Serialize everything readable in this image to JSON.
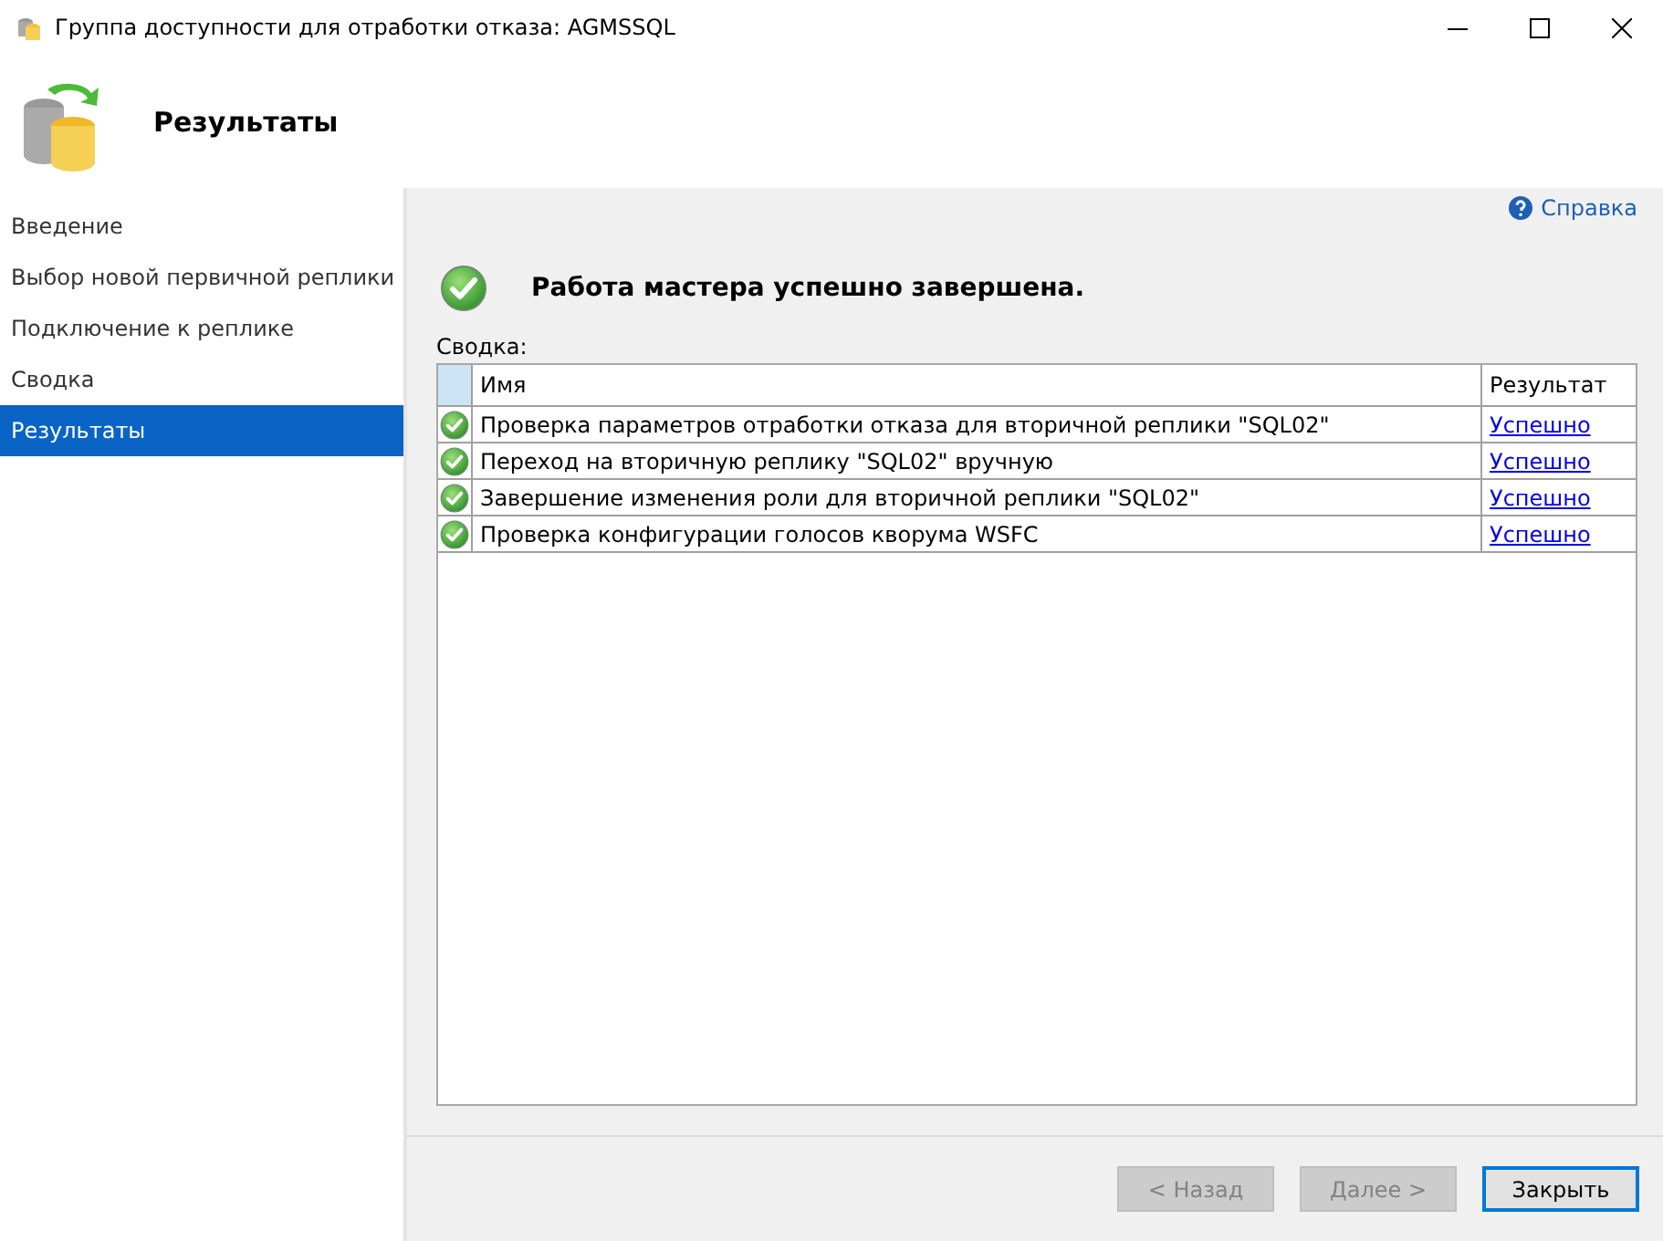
{
  "window": {
    "title": "Группа доступности для отработки отказа: AGMSSQL"
  },
  "header": {
    "title": "Результаты"
  },
  "sidebar": {
    "items": [
      {
        "label": "Введение",
        "selected": false
      },
      {
        "label": "Выбор новой первичной реплики",
        "selected": false
      },
      {
        "label": "Подключение к реплике",
        "selected": false
      },
      {
        "label": "Сводка",
        "selected": false
      },
      {
        "label": "Результаты",
        "selected": true
      }
    ]
  },
  "help_link": "Справка",
  "status_message": "Работа мастера успешно завершена.",
  "summary_label": "Сводка:",
  "table": {
    "columns": [
      "Имя",
      "Результат"
    ],
    "rows": [
      {
        "name": "Проверка параметров отработки отказа для вторичной реплики \"SQL02\"",
        "result": "Успешно",
        "kind": "success"
      },
      {
        "name": "Переход на вторичную реплику \"SQL02\" вручную",
        "result": "Успешно",
        "kind": "success"
      },
      {
        "name": "Завершение изменения роли для вторичной реплики \"SQL02\"",
        "result": "Успешно",
        "kind": "success"
      },
      {
        "name": "Проверка конфигурации голосов кворума WSFC",
        "result": "Успешно",
        "kind": "success"
      }
    ]
  },
  "buttons": [
    {
      "label": "< Назад",
      "disabled": true,
      "default": false
    },
    {
      "label": "Далее >",
      "disabled": true,
      "default": false
    },
    {
      "label": "Закрыть",
      "disabled": false,
      "default": true
    }
  ]
}
